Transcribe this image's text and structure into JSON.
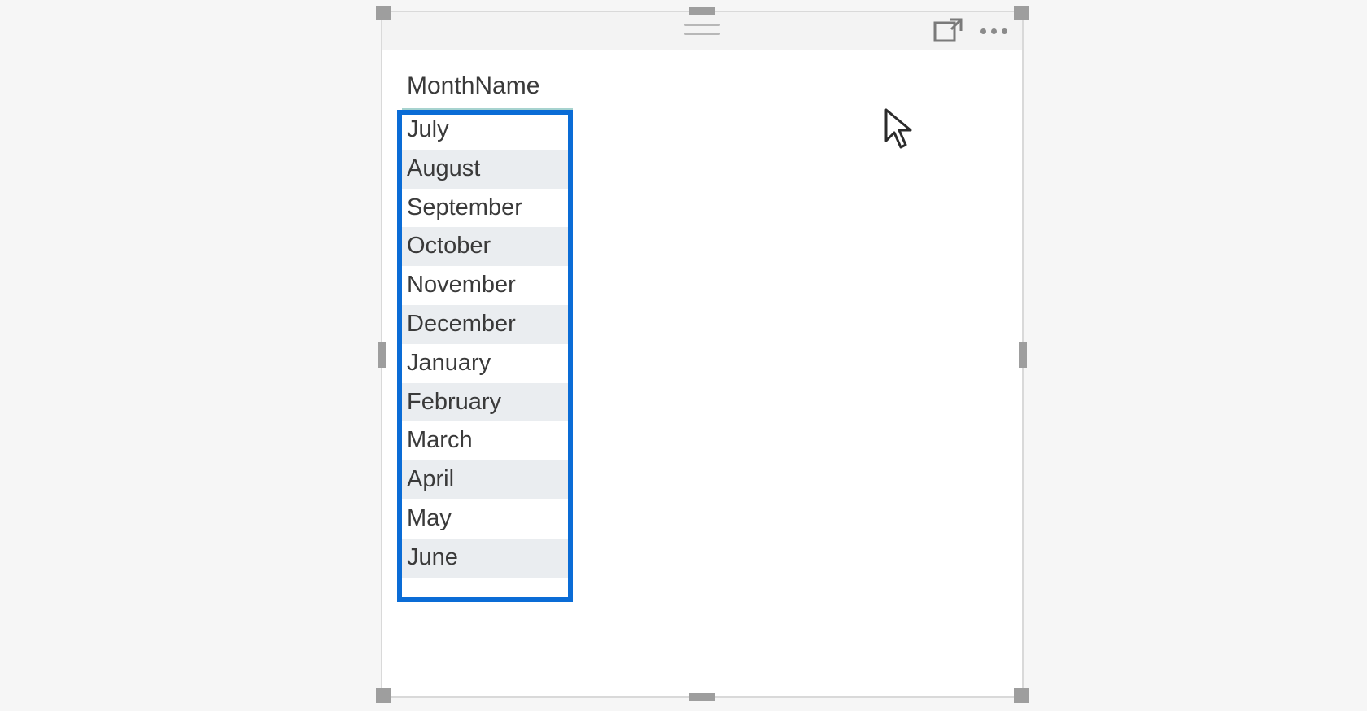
{
  "table": {
    "header": "MonthName",
    "rows": [
      "July",
      "August",
      "September",
      "October",
      "November",
      "December",
      "January",
      "February",
      "March",
      "April",
      "May",
      "June"
    ]
  },
  "icons": {
    "focus": "focus-mode-icon",
    "more": "more-options-icon",
    "drag": "drag-handle-icon"
  },
  "colors": {
    "selection_handle": "#9e9e9e",
    "annotation_box": "#0a6cd6",
    "row_alt_bg": "#eaedf0",
    "header_underline": "#a7d3cf"
  }
}
